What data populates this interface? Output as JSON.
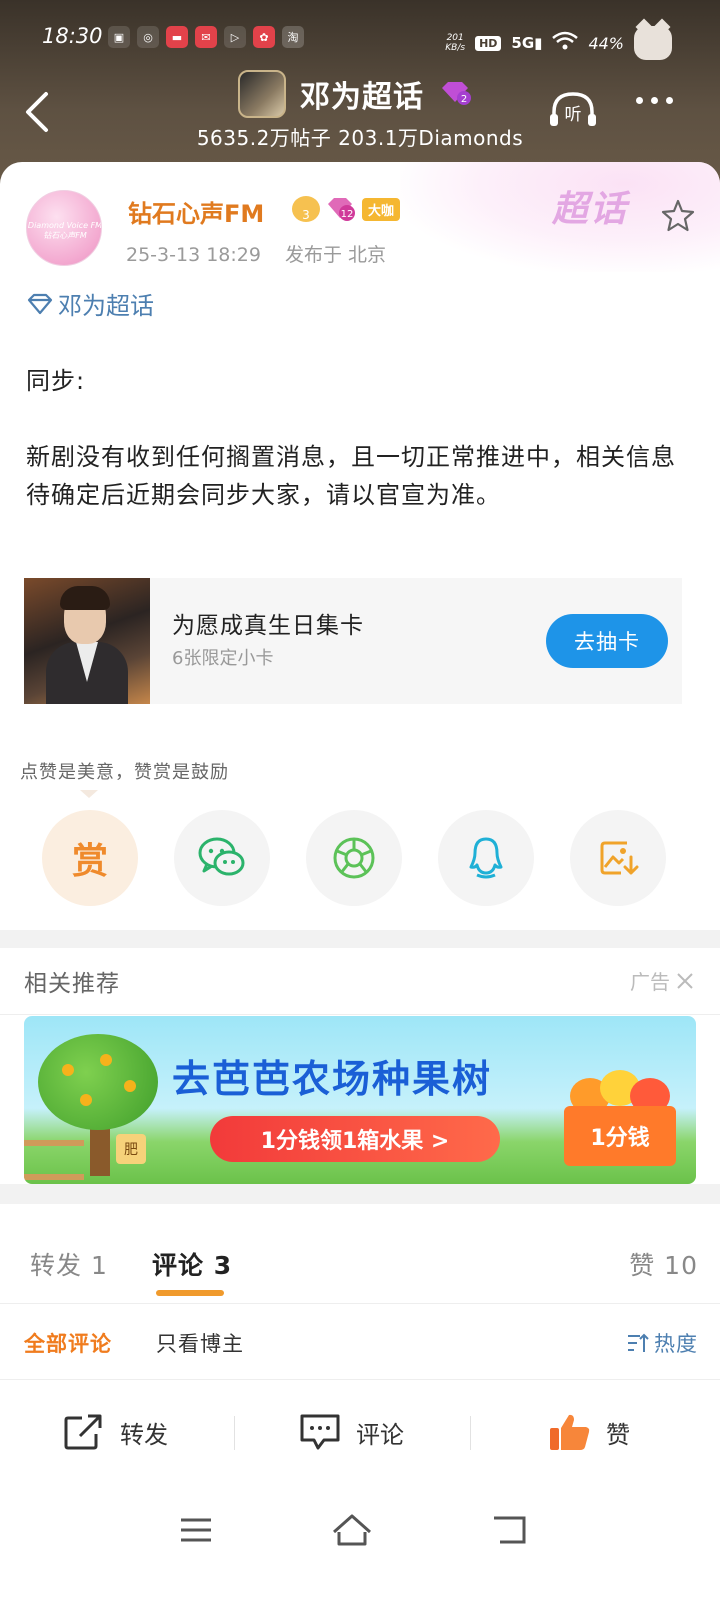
{
  "status_bar": {
    "time": "18:30",
    "net_speed_value": "201",
    "net_speed_unit": "KB/s",
    "hd": "HD",
    "signal": "5G",
    "battery": "44%"
  },
  "header": {
    "topic_name": "邓为超话",
    "topic_level": "2",
    "stats": "5635.2万帖子 203.1万Diamonds",
    "listen_label": "听"
  },
  "post": {
    "deco_text": "超话",
    "author_avatar_text": "Diamond Voice FM 钻石心声FM",
    "author_name": "钻石心声FM",
    "crown_level": "3",
    "gem_level": "12",
    "vip_label": "大咖",
    "date": "25-3-13 18:29",
    "location": "发布于 北京",
    "topic_tag": "邓为超话",
    "body": [
      "同步:",
      "新剧没有收到任何搁置消息，且一切正常推进中，相关信息待确定后近期会同步大家，请以官宣为准。"
    ],
    "promo": {
      "title": "为愿成真生日集卡",
      "subtitle": "6张限定小卡",
      "button": "去抽卡"
    },
    "reward_hint": "点赞是美意，赞赏是鼓励",
    "share": {
      "reward_label": "赏",
      "icons": [
        "wechat-icon",
        "moments-icon",
        "qq-icon",
        "save-image-icon"
      ]
    }
  },
  "recommend": {
    "title": "相关推荐",
    "ad_label": "广告",
    "banner": {
      "title": "去芭芭农场种果树",
      "pill": "1分钱领1箱水果 >",
      "box_label": "1分钱",
      "sign": "肥"
    }
  },
  "tabs": {
    "repost": "转发 1",
    "comment": "评论 3",
    "like": "赞 10"
  },
  "filters": {
    "all": "全部评论",
    "owner": "只看博主",
    "sort": "热度"
  },
  "action_bar": {
    "repost": "转发",
    "comment": "评论",
    "like": "赞"
  },
  "colors": {
    "accent_orange": "#f07c1e",
    "link_blue": "#4d7fb0",
    "button_blue": "#1e94e8",
    "header_brown": "#5e5142"
  }
}
